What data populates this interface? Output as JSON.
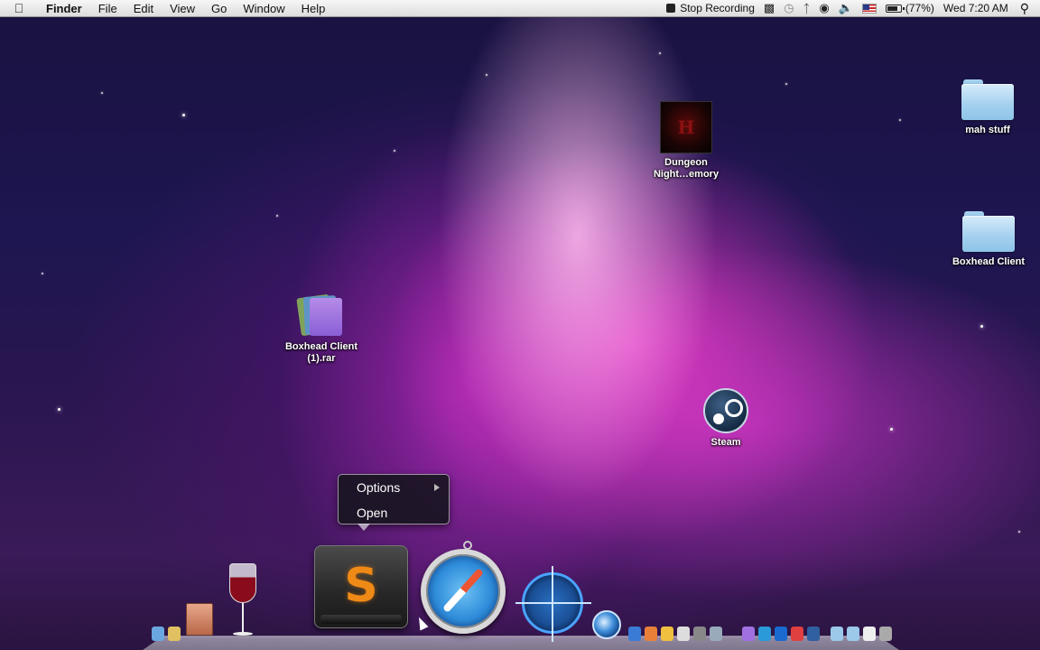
{
  "menubar": {
    "apple_icon": "apple-logo-icon",
    "app_name": "Finder",
    "menus": [
      "File",
      "Edit",
      "View",
      "Go",
      "Window",
      "Help"
    ],
    "stop_recording": "Stop Recording",
    "battery": "(77%)",
    "battery_level": 0.77,
    "clock": "Wed 7:20 AM"
  },
  "desktop": {
    "icons": [
      {
        "label": "mah stuff",
        "icon": "folder-icon"
      },
      {
        "label": "Boxhead Client",
        "icon": "folder-icon"
      },
      {
        "label": "Dungeon\nNight…emory",
        "icon": "game-thumbnail-icon"
      },
      {
        "label": "Boxhead Client\n(1).rar",
        "icon": "archive-icon"
      },
      {
        "label": "Steam",
        "icon": "steam-icon"
      }
    ]
  },
  "context_menu": {
    "items": [
      "Options",
      "Open"
    ]
  },
  "dock": {
    "apps": [
      "finder-icon",
      "archive-utility-icon",
      "wine-icon",
      "sublime-text-icon",
      "safari-icon",
      "scope-app-icon",
      "quicktime-icon"
    ]
  },
  "colors": {
    "menubar_bg": "#e8e8e8",
    "menu_bg": "#14141c",
    "wallpaper_accent": "#e04cc8"
  }
}
